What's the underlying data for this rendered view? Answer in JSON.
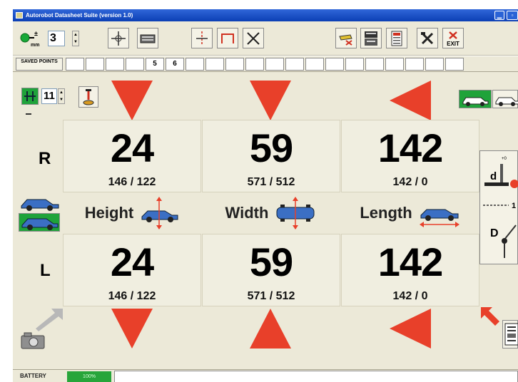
{
  "window": {
    "title": "Autorobot Datasheet Suite (version 1.0)"
  },
  "toolbar": {
    "step_value": "3",
    "icons": [
      "mm-step-icon",
      "crosshair-icon",
      "keyboard-icon",
      "center-line-icon",
      "frame-icon",
      "cross-diagonal-icon",
      "eraser-icon",
      "print-preview-icon",
      "calculator-icon",
      "tools-icon",
      "exit-icon"
    ],
    "exit_label": "EXIT"
  },
  "saved_points": {
    "label": "SAVED POINTS",
    "slots": [
      "",
      "",
      "",
      "",
      "5",
      "6",
      "",
      "",
      "",
      "",
      "",
      "",
      "",
      "",
      "",
      "",
      "",
      "",
      "",
      ""
    ]
  },
  "controls": {
    "point_value": "11"
  },
  "rows": {
    "right_label": "R",
    "left_label": "L"
  },
  "measurements": {
    "right": [
      {
        "value": "24",
        "detail": "146  / 122"
      },
      {
        "value": "59",
        "detail": "571  / 512"
      },
      {
        "value": "142",
        "detail": "142  / 0"
      }
    ],
    "left": [
      {
        "value": "24",
        "detail": "146  / 122"
      },
      {
        "value": "59",
        "detail": "571  / 512"
      },
      {
        "value": "142",
        "detail": "142  / 0"
      }
    ]
  },
  "dimensions": [
    {
      "label": "Height"
    },
    {
      "label": "Width"
    },
    {
      "label": "Length"
    }
  ],
  "side_panel": {
    "d_small": "d",
    "d_big": "D",
    "tick_label": "+0",
    "scale_label": "1"
  },
  "status": {
    "battery_label": "BATTERY",
    "battery_level_text": "100%",
    "battery_level": 1.0
  },
  "colors": {
    "arrow_red": "#e8402a",
    "title_blue": "#1c4fc6",
    "battery_green": "#27a53a",
    "toggle_green": "#1fa33a"
  }
}
